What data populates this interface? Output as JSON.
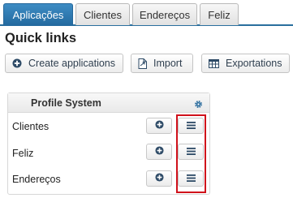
{
  "tabs": [
    {
      "label": "Aplicações",
      "active": true
    },
    {
      "label": "Clientes",
      "active": false
    },
    {
      "label": "Endereços",
      "active": false
    },
    {
      "label": "Feliz",
      "active": false
    }
  ],
  "page": {
    "title": "Quick links"
  },
  "toolbar": {
    "create_label": "Create applications",
    "import_label": "Import",
    "exportations_label": "Exportations"
  },
  "panel": {
    "title": "Profile System",
    "rows": [
      {
        "label": "Clientes"
      },
      {
        "label": "Feliz"
      },
      {
        "label": "Endereços"
      }
    ]
  },
  "icons": {
    "create": "plus-circle-icon",
    "import": "file-import-icon",
    "exportations": "table-icon",
    "settings": "gear-icon",
    "add": "plus-circle-icon",
    "menu": "list-icon"
  },
  "colors": {
    "accent": "#2a6f9e",
    "highlight": "#d0111b"
  }
}
